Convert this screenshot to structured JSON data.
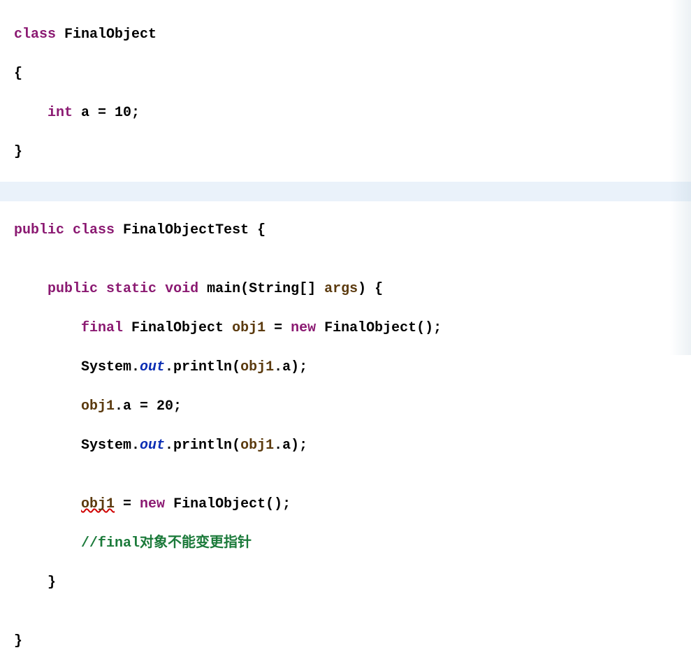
{
  "code": {
    "l1_kw_class": "class",
    "l1_name": "FinalObject",
    "l2_brace_open": "{",
    "l3_indent": "    ",
    "l3_kw_int": "int",
    "l3_rest": " a = 10;",
    "l4_brace_close": "}",
    "l5_blank": " ",
    "l6_kw_public": "public",
    "l6_kw_class": "class",
    "l6_rest": " FinalObjectTest {",
    "l7_blank": "",
    "l8_indent": "    ",
    "l8_kw_public": "public",
    "l8_kw_static": "static",
    "l8_kw_void": "void",
    "l8_main": " main(String[] ",
    "l8_args": "args",
    "l8_end": ") {",
    "l9_indent": "        ",
    "l9_kw_final": "final",
    "l9_type": " FinalObject ",
    "l9_var": "obj1",
    "l9_eq": " = ",
    "l9_kw_new": "new",
    "l9_ctor": " FinalObject();",
    "l10_indent": "        ",
    "l10_sys": "System.",
    "l10_out": "out",
    "l10_print": ".println(",
    "l10_obj": "obj1",
    "l10_end": ".a);",
    "l11_indent": "        ",
    "l11_obj": "obj1",
    "l11_rest": ".a = 20;",
    "l12_indent": "        ",
    "l12_sys": "System.",
    "l12_out": "out",
    "l12_print": ".println(",
    "l12_obj": "obj1",
    "l12_end": ".a);",
    "l13_blank": "",
    "l14_indent": "        ",
    "l14_obj_err": "obj1",
    "l14_eq": " = ",
    "l14_kw_new": "new",
    "l14_ctor": " FinalObject();",
    "l15_indent": "        ",
    "l15_comment": "//final对象不能变更指针",
    "l16_indent": "    ",
    "l16_brace": "}",
    "l17_blank": "",
    "l18_brace": "}"
  }
}
